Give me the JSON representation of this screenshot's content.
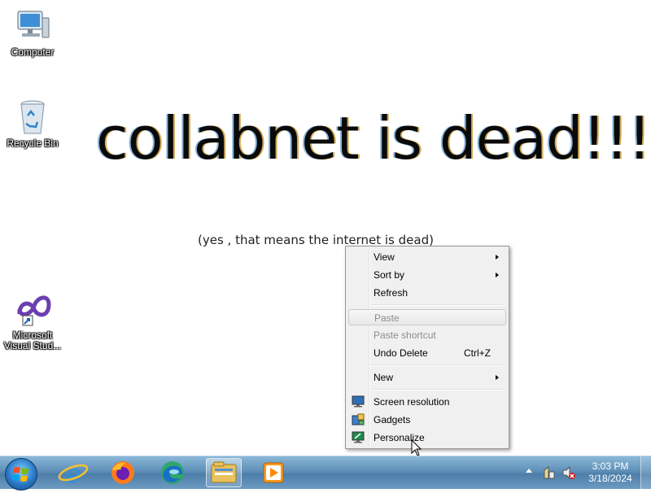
{
  "desktop": {
    "icons": [
      {
        "label": "Computer"
      },
      {
        "label": "Recycle Bin"
      },
      {
        "label": "Microsoft Visual Stud..."
      }
    ],
    "wallpaper": {
      "headline": "collabnet is dead!!!!",
      "subline": "(yes , that means the internet is dead)"
    }
  },
  "context_menu": {
    "items": [
      {
        "label": "View",
        "submenu": true
      },
      {
        "label": "Sort by",
        "submenu": true
      },
      {
        "label": "Refresh"
      },
      {
        "label": "Paste",
        "disabled": true
      },
      {
        "label": "Paste shortcut",
        "disabled": true
      },
      {
        "label": "Undo Delete",
        "shortcut": "Ctrl+Z"
      },
      {
        "label": "New",
        "submenu": true
      },
      {
        "label": "Screen resolution",
        "icon": "screen-resolution-icon"
      },
      {
        "label": "Gadgets",
        "icon": "gadgets-icon"
      },
      {
        "label": "Personalize",
        "icon": "personalize-icon"
      }
    ]
  },
  "taskbar": {
    "apps": [
      "start-orb-icon",
      "internet-explorer-icon",
      "firefox-icon",
      "edge-icon",
      "file-explorer-icon",
      "media-player-icon"
    ],
    "tray": [
      "show-hidden-icons",
      "action-center-icon",
      "volume-muted-icon"
    ],
    "clock": {
      "time": "3:03 PM",
      "date": "3/18/2024"
    }
  }
}
